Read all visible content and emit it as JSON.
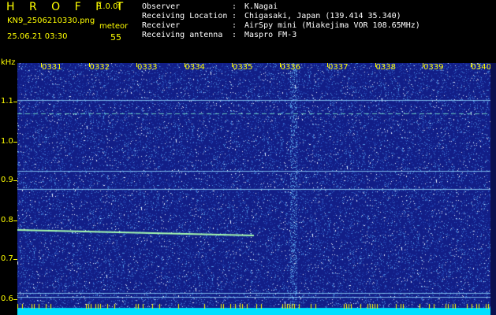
{
  "header": {
    "app_title": "H R O F F T",
    "version": "1.0.0f",
    "filename": "KN9_2506210330.png",
    "mode": "meteor",
    "datetime": "25.06.21 03:30",
    "count": "55"
  },
  "info": [
    {
      "label": "Observer",
      "value": "K.Nagai"
    },
    {
      "label": "Receiving Location",
      "value": "Chigasaki, Japan (139.414 35.340)"
    },
    {
      "label": "Receiver",
      "value": "AirSpy mini (Miakejima VOR 108.65MHz)"
    },
    {
      "label": "Receiving antenna",
      "value": "Maspro FM-3"
    }
  ],
  "separator": ":",
  "axis": {
    "unit": "kHz",
    "y_ticks": [
      "1.1",
      "1.0",
      "0.9",
      "0.8",
      "0.7",
      "0.6"
    ],
    "time_ticks": [
      "0331",
      "0332",
      "0333",
      "0334",
      "0335",
      "0336",
      "0337",
      "0338",
      "0339",
      "0340"
    ]
  },
  "colors": {
    "background": "#13208a",
    "text_accent": "#ffff00",
    "signal": "#a8ffb0",
    "bottom_band": "#00e0ff"
  }
}
